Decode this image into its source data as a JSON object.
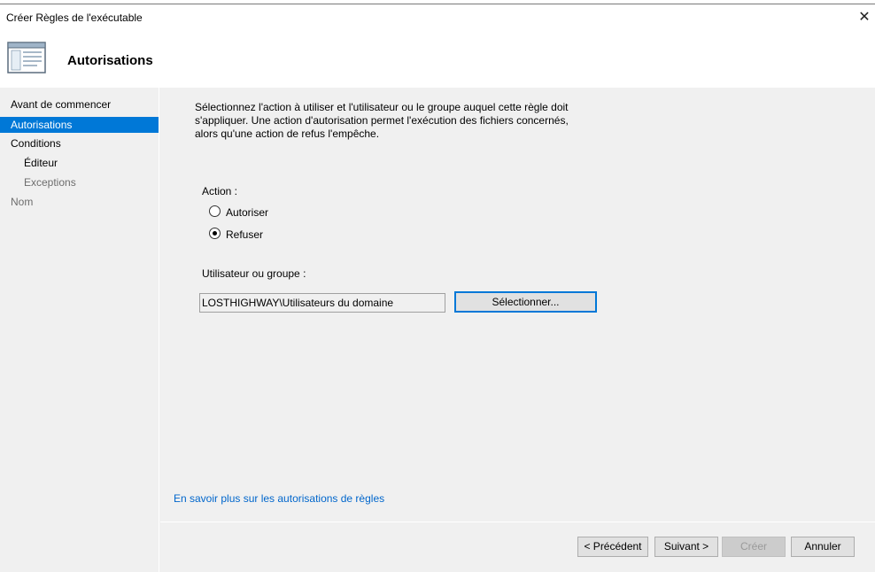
{
  "window": {
    "title": "Créer Règles de l'exécutable",
    "close_glyph": "✕"
  },
  "header": {
    "icon": "window-app-icon",
    "title": "Autorisations"
  },
  "sidebar": {
    "items": [
      {
        "label": "Avant de commencer",
        "state": "normal"
      },
      {
        "label": "Autorisations",
        "state": "active"
      },
      {
        "label": "Conditions",
        "state": "normal"
      },
      {
        "label": "Éditeur",
        "state": "normal"
      },
      {
        "label": "Exceptions",
        "state": "disabled"
      },
      {
        "label": "Nom",
        "state": "disabled"
      }
    ]
  },
  "main": {
    "instructions": "Sélectionnez l'action à utiliser et l'utilisateur ou le groupe auquel cette règle doit s'appliquer. Une action d'autorisation permet l'exécution des fichiers concernés, alors qu'une action de refus l'empêche.",
    "action_label": "Action :",
    "actions": [
      {
        "label": "Autoriser",
        "checked": false
      },
      {
        "label": "Refuser",
        "checked": true
      }
    ],
    "user_label": "Utilisateur ou groupe :",
    "user_value": "LOSTHIGHWAY\\Utilisateurs du domaine",
    "select_button": "Sélectionner...",
    "learn_more_link": "En savoir plus sur les autorisations de règles"
  },
  "footer": {
    "previous": "< Précédent",
    "next": "Suivant >",
    "create": "Créer",
    "cancel": "Annuler"
  },
  "colors": {
    "accent": "#0078d7",
    "link": "#0066cc",
    "panel_bg": "#f0f0f0"
  }
}
